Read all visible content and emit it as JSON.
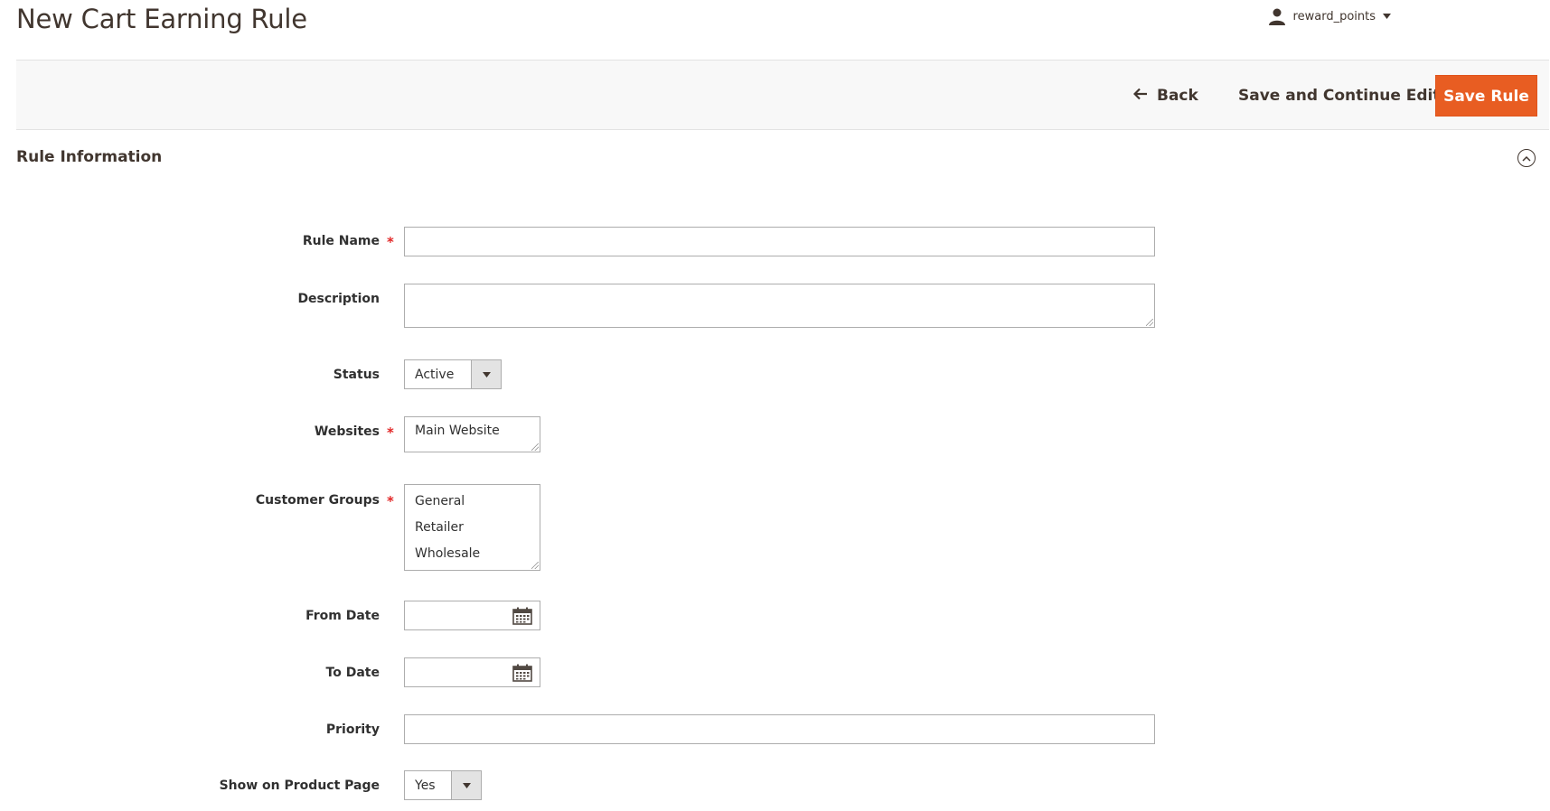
{
  "header": {
    "title": "New Cart Earning Rule",
    "user": "reward_points"
  },
  "toolbar": {
    "back_label": "Back",
    "save_continue_label": "Save and Continue Edit",
    "save_label": "Save Rule"
  },
  "section": {
    "title": "Rule Information"
  },
  "form": {
    "rule_name": {
      "label": "Rule Name",
      "required": "*",
      "value": ""
    },
    "description": {
      "label": "Description",
      "value": ""
    },
    "status": {
      "label": "Status",
      "value": "Active"
    },
    "websites": {
      "label": "Websites",
      "required": "*",
      "options": [
        "Main Website"
      ]
    },
    "customer_groups": {
      "label": "Customer Groups",
      "required": "*",
      "options": [
        "General",
        "Retailer",
        "Wholesale"
      ]
    },
    "from_date": {
      "label": "From Date",
      "value": ""
    },
    "to_date": {
      "label": "To Date",
      "value": ""
    },
    "priority": {
      "label": "Priority",
      "value": ""
    },
    "show_on_product_page": {
      "label": "Show on Product Page",
      "value": "Yes"
    }
  },
  "colors": {
    "primary_button": "#e85d22",
    "required_mark": "#e22626",
    "toolbar_bg": "#f8f8f8"
  },
  "icons": [
    "user-icon",
    "chevron-down-icon",
    "arrow-left-icon",
    "collapse-up-icon",
    "calendar-icon"
  ]
}
